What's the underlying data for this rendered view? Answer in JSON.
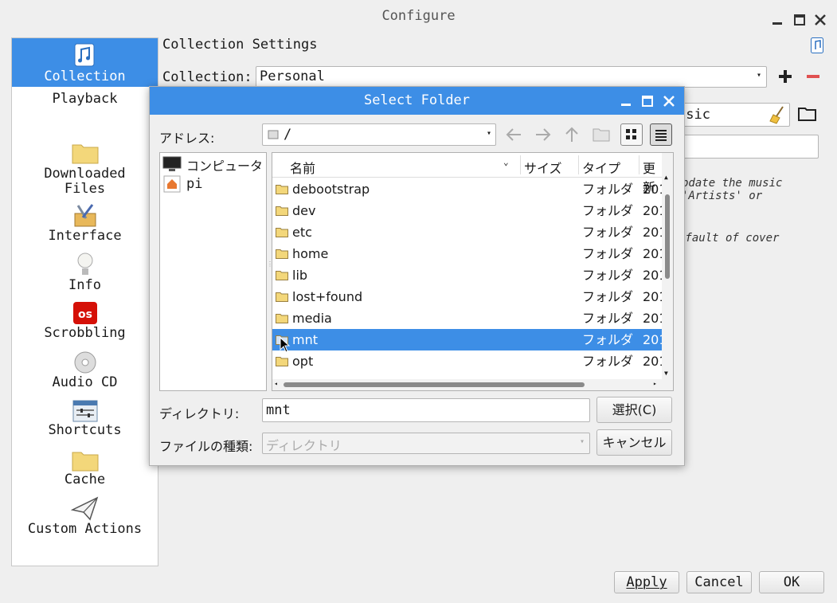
{
  "window": {
    "title": "Configure"
  },
  "sidebar": {
    "items": [
      {
        "label": "Collection",
        "icon": "music-note-icon"
      },
      {
        "label": "Playback",
        "icon": ""
      },
      {
        "label": "Downloaded\nFiles",
        "icon": "folder-icon"
      },
      {
        "label": "Interface",
        "icon": "tools-icon"
      },
      {
        "label": "Info",
        "icon": "lightbulb-icon"
      },
      {
        "label": "Scrobbling",
        "icon": "lastfm-icon"
      },
      {
        "label": "Audio CD",
        "icon": "cd-icon"
      },
      {
        "label": "Shortcuts",
        "icon": "sliders-icon"
      },
      {
        "label": "Cache",
        "icon": "folder-icon"
      },
      {
        "label": "Custom Actions",
        "icon": "paper-plane-icon"
      }
    ]
  },
  "collection": {
    "heading": "Collection Settings",
    "collection_label": "Collection:",
    "collection_value": "Personal",
    "folder_value_fragment": "usic",
    "hint_line1": "pdate the music",
    "hint_line2": "'Artists' or",
    "hint_line3": "efault of cover"
  },
  "footer": {
    "apply_label": "Apply",
    "cancel_label": "Cancel",
    "ok_label": "OK"
  },
  "dialog": {
    "title": "Select Folder",
    "address_label": "アドレス:",
    "address_value": "/",
    "places": [
      {
        "label": "コンピュータ",
        "icon": "monitor-icon"
      },
      {
        "label": "pi",
        "icon": "home-icon"
      }
    ],
    "columns": {
      "name": "名前",
      "size": "サイズ",
      "type": "タイプ",
      "modified": "更新"
    },
    "rows": [
      {
        "name": "debootstrap",
        "type": "フォルダ",
        "date": "201"
      },
      {
        "name": "dev",
        "type": "フォルダ",
        "date": "201"
      },
      {
        "name": "etc",
        "type": "フォルダ",
        "date": "201"
      },
      {
        "name": "home",
        "type": "フォルダ",
        "date": "201"
      },
      {
        "name": "lib",
        "type": "フォルダ",
        "date": "201"
      },
      {
        "name": "lost+found",
        "type": "フォルダ",
        "date": "201"
      },
      {
        "name": "media",
        "type": "フォルダ",
        "date": "201"
      },
      {
        "name": "mnt",
        "type": "フォルダ",
        "date": "201"
      },
      {
        "name": "opt",
        "type": "フォルダ",
        "date": "201"
      }
    ],
    "selected_row": 7,
    "directory_label": "ディレクトリ:",
    "directory_value": "mnt",
    "filetype_label": "ファイルの種類:",
    "filetype_value": "ディレクトリ",
    "select_button": "選択(C)",
    "cancel_button": "キャンセル"
  },
  "colors": {
    "accent": "#3d8ee6",
    "remove": "#e05050",
    "folder": "#f3d77a"
  }
}
